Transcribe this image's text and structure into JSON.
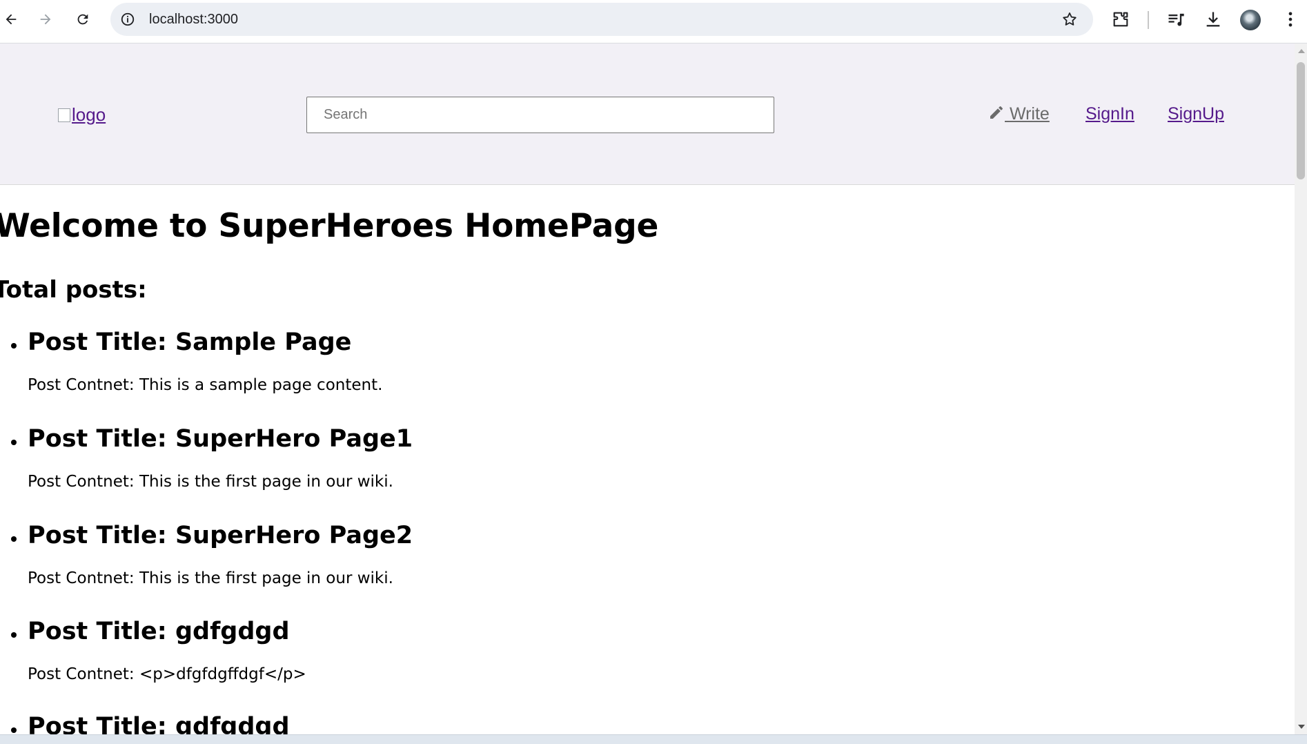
{
  "browser": {
    "url": "localhost:3000"
  },
  "header": {
    "logo_alt": "logo",
    "search_placeholder": "Search",
    "nav": {
      "write": "Write",
      "signin": "SignIn",
      "signup": "SignUp"
    }
  },
  "main": {
    "heading": "Welcome to SuperHeroes HomePage",
    "total_posts_label": "Total posts:",
    "posts": [
      {
        "title": "Post Title: Sample Page",
        "content": "Post Contnet: This is a sample page content."
      },
      {
        "title": "Post Title: SuperHero Page1",
        "content": "Post Contnet: This is the first page in our wiki."
      },
      {
        "title": "Post Title: SuperHero Page2",
        "content": "Post Contnet: This is the first page in our wiki."
      },
      {
        "title": "Post Title: gdfgdgd",
        "content": "Post Contnet: <p>dfgfdgffdgf</p>"
      },
      {
        "title": "Post Title: gdfgdgd",
        "content": ""
      }
    ]
  }
}
